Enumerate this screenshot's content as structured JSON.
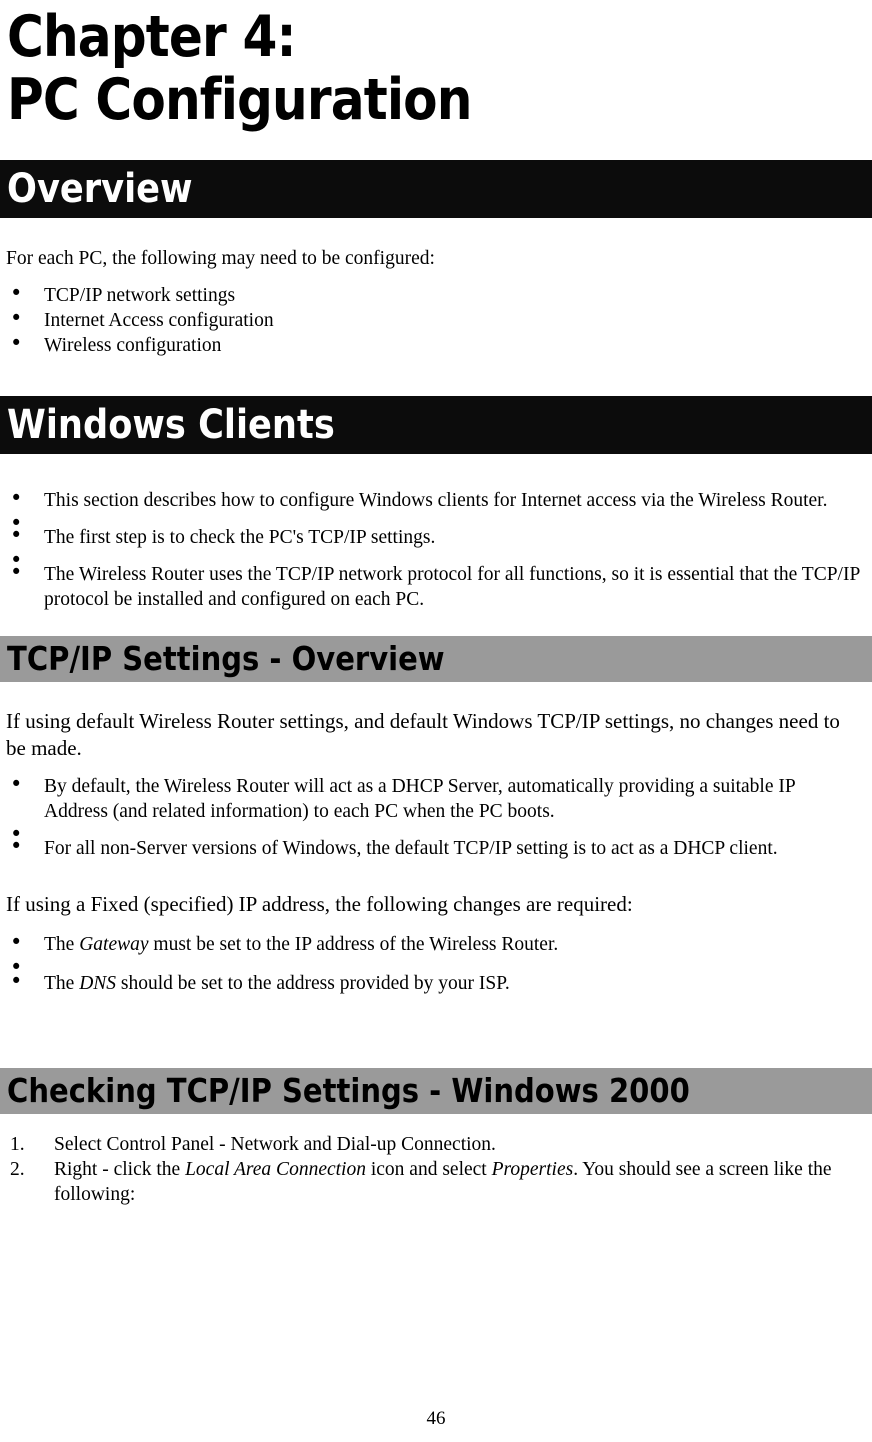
{
  "document": {
    "chapter_title_line1": "Chapter 4:",
    "chapter_title_line2": "PC Configuration",
    "page_number": "46"
  },
  "sections": {
    "overview": {
      "heading": "Overview",
      "intro": "For each PC, the following may need to be configured:",
      "bullets": [
        "TCP/IP network settings",
        "Internet Access configuration",
        "Wireless configuration"
      ]
    },
    "windows_clients": {
      "heading": "Windows Clients",
      "bullets": [
        "This section describes how to configure Windows clients for Internet access via the Wireless Router.",
        "The first step is to check the PC's TCP/IP settings.",
        "The Wireless  Router uses the TCP/IP network protocol for all functions, so it is essential that the TCP/IP protocol be installed and configured on each PC."
      ]
    },
    "tcpip_settings_overview": {
      "heading": "TCP/IP Settings - Overview",
      "lead_default": "If using default Wireless  Router settings, and default Windows TCP/IP settings, no changes need to be made.",
      "default_bullets": [
        "By default, the Wireless  Router will act as a DHCP Server, automatically providing a suitable IP Address (and related information) to each PC when the PC boots.",
        "For all non-Server versions of Windows, the default TCP/IP setting is to act as a DHCP client."
      ],
      "lead_fixed": "If using a Fixed (specified) IP address, the following changes are required:",
      "fixed_bullets": [
        {
          "prefix": "The ",
          "emphasis": "Gateway",
          "suffix": " must be set to the IP address of the Wireless  Router."
        },
        {
          "prefix": "The ",
          "emphasis": "DNS",
          "suffix": " should be set to the address provided by your ISP."
        }
      ]
    },
    "checking_win2000": {
      "heading": "Checking TCP/IP Settings - Windows 2000",
      "steps": [
        {
          "text": "Select Control Panel - Network and Dial-up Connection."
        },
        {
          "seg1": "Right - click the ",
          "em1": "Local Area Connection",
          "seg2": " icon and select ",
          "em2": "Properties",
          "seg3": ". You should see a screen like the following:"
        }
      ]
    }
  }
}
